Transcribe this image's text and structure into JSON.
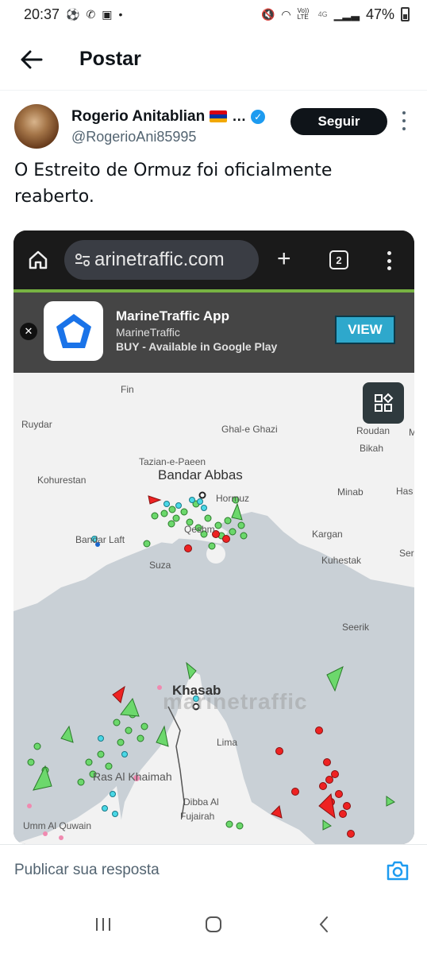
{
  "status_bar": {
    "time": "20:37",
    "network": "4G",
    "battery": "47%",
    "volte": "Vo)) LTE"
  },
  "header": {
    "title": "Postar"
  },
  "post": {
    "author_name": "Rogerio Anitablian",
    "author_handle": "@RogerioAni85995",
    "follow_label": "Seguir",
    "text": "O Estreito de Ormuz foi oficialmente reaberto."
  },
  "browser": {
    "url": "arinetraffic.com",
    "tab_count": "2",
    "banner": {
      "title": "MarineTraffic App",
      "publisher": "MarineTraffic",
      "cta_text": "BUY - Available in Google Play",
      "view_label": "VIEW"
    }
  },
  "map": {
    "labels": {
      "fin": "Fin",
      "ruydar": "Ruydar",
      "ghal_e_ghazi": "Ghal-e Ghazi",
      "roudan": "Roudan",
      "bikah": "Bikah",
      "tazian": "Tazian-e-Paeen",
      "kohurestan": "Kohurestan",
      "bandar_abbas": "Bandar Abbas",
      "hormuz": "Hormuz",
      "minab": "Minab",
      "has": "Has",
      "bandar_laft": "Bandar Laft",
      "qeshm": "Qeshm",
      "kargan": "Kargan",
      "ser": "Ser",
      "suza": "Suza",
      "kuhestak": "Kuhestak",
      "seerik": "Seerik",
      "khasab": "Khasab",
      "lima": "Lima",
      "ras_al_khaimah": "Ras Al Khaimah",
      "dibba": "Dibba Al",
      "fujairah": "Fujairah",
      "umm_al_quwain": "Umm Al Quwain",
      "edge_m": "M"
    },
    "watermark": "marinetraffic"
  },
  "reply": {
    "placeholder": "Publicar sua resposta"
  }
}
